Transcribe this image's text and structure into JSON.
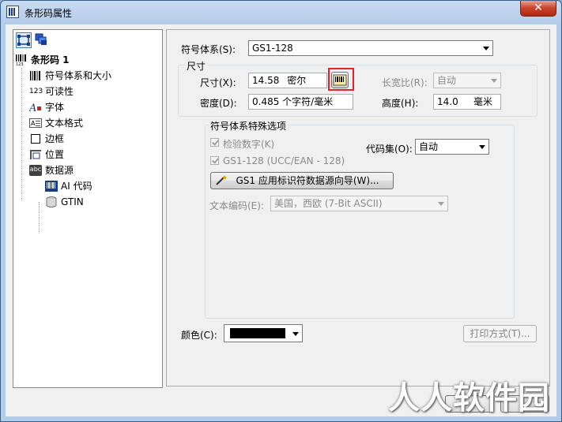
{
  "window": {
    "title": "条形码属性",
    "close_label": "✕"
  },
  "tree": {
    "root": "条形码 1",
    "items": [
      {
        "label": "符号体系和大小",
        "icon": "barcode-icon"
      },
      {
        "label": "可读性",
        "icon": "readability-icon",
        "icon_text": "123"
      },
      {
        "label": "字体",
        "icon": "font-icon"
      },
      {
        "label": "文本格式",
        "icon": "text-format-icon"
      },
      {
        "label": "边框",
        "icon": "border-icon"
      },
      {
        "label": "位置",
        "icon": "position-icon"
      },
      {
        "label": "数据源",
        "icon": "datasource-icon",
        "icon_text": "abc"
      }
    ],
    "children": [
      {
        "label": "AI 代码",
        "icon": "ai-code-icon"
      },
      {
        "label": "GTIN",
        "icon": "database-icon"
      }
    ]
  },
  "symbology": {
    "label": "符号体系(S):",
    "value": "GS1-128"
  },
  "size_group": {
    "title": "尺寸",
    "size_label": "尺寸(X):",
    "size_value": "14.58",
    "size_unit": "密尔",
    "density_label": "密度(D):",
    "density_value": "0.485 个字符/毫米",
    "ratio_label": "长宽比(R):",
    "ratio_value": "自动",
    "height_label": "高度(H):",
    "height_value": "14.0",
    "height_unit": "毫米"
  },
  "special_group": {
    "title": "符号体系特殊选项",
    "check_digit": "检验数字(K)",
    "gs1_ucc": "GS1-128 (UCC/EAN - 128)",
    "wizard_button": "GS1 应用标识符数据源向导(W)...",
    "codeset_label": "代码集(O):",
    "codeset_value": "自动",
    "encoding_label": "文本编码(E):",
    "encoding_value": "美国，西欧 (7-Bit ASCII)"
  },
  "color": {
    "label": "颜色(C):",
    "value_hex": "#000000"
  },
  "print_button": "打印方式(T)...",
  "watermark": "人人软件园"
}
